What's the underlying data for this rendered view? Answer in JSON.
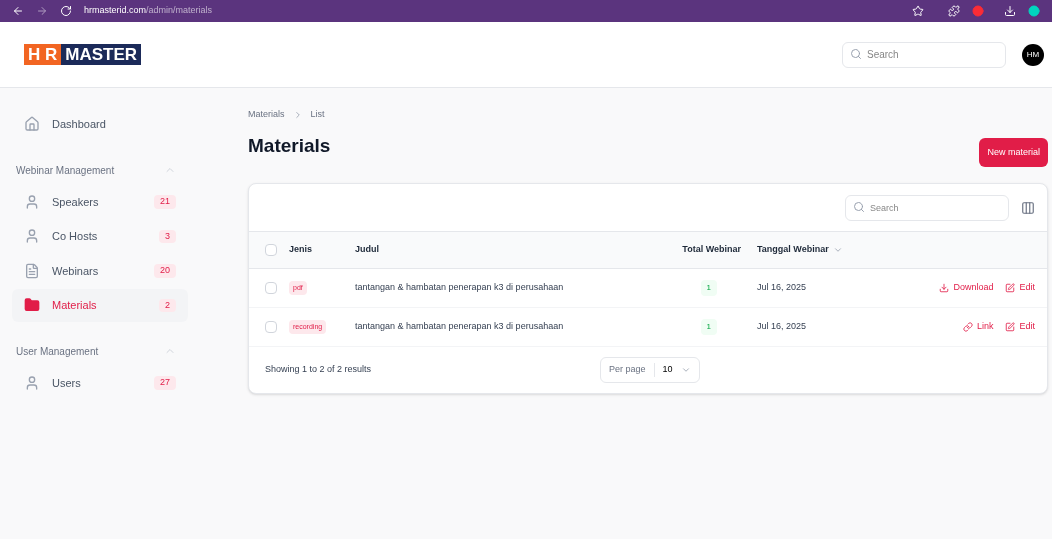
{
  "browser": {
    "url_host": "hrmasterid.com",
    "url_path": "/admin/materials"
  },
  "header": {
    "logo": {
      "left": "H R",
      "right": "MASTER"
    },
    "search": {
      "placeholder": "Search"
    },
    "avatar": "HM"
  },
  "sidebar": {
    "items": [
      {
        "label": "Dashboard",
        "selected": false
      }
    ],
    "groups": [
      {
        "label": "Webinar Management",
        "expanded": true,
        "items": [
          {
            "kind": "person",
            "label": "Speakers",
            "count": "21",
            "selected": false
          },
          {
            "kind": "person",
            "label": "Co Hosts",
            "count": "3",
            "selected": false
          },
          {
            "kind": "document",
            "label": "Webinars",
            "count": "20",
            "selected": false
          },
          {
            "kind": "folder",
            "label": "Materials",
            "count": "2",
            "selected": true
          }
        ]
      },
      {
        "label": "User Management",
        "expanded": true,
        "items": [
          {
            "kind": "person",
            "label": "Users",
            "count": "27",
            "selected": false
          }
        ]
      }
    ]
  },
  "breadcrumbs": [
    "Materials",
    "List"
  ],
  "title": "Materials",
  "new_button": "New material",
  "table": {
    "search": {
      "placeholder": "Search"
    },
    "all_checked": false,
    "columns": [
      {
        "label": "Jenis",
        "sortable": false
      },
      {
        "label": "Judul",
        "sortable": false
      },
      {
        "label": "Total Webinar",
        "sortable": false
      },
      {
        "label": "Tanggal Webinar",
        "sortable": true
      }
    ],
    "rows": [
      {
        "checked": false,
        "jenis": "pdf",
        "judul": "tantangan & hambatan penerapan k3 di perusahaan",
        "total": "1",
        "tanggal": "Jul 16, 2025",
        "actions": [
          {
            "kind": "download",
            "label": "Download"
          },
          {
            "kind": "edit",
            "label": "Edit"
          }
        ]
      },
      {
        "checked": false,
        "jenis": "recording",
        "judul": "tantangan & hambatan penerapan k3 di perusahaan",
        "total": "1",
        "tanggal": "Jul 16, 2025",
        "actions": [
          {
            "kind": "link",
            "label": "Link"
          },
          {
            "kind": "edit",
            "label": "Edit"
          }
        ]
      }
    ],
    "footer": {
      "summary": "Showing 1 to 2 of 2 results",
      "per_page_label": "Per page",
      "per_page": "10"
    }
  }
}
